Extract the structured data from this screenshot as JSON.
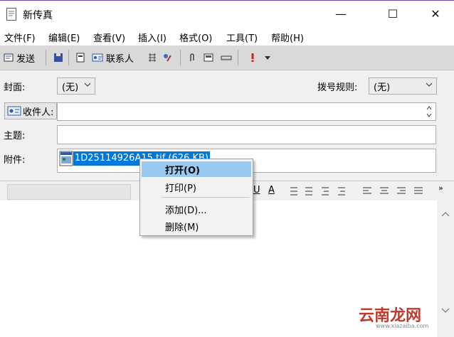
{
  "window": {
    "title": "新传真",
    "minimize": "—",
    "maximize": "☐",
    "close": "✕"
  },
  "menu": [
    "文件(F)",
    "编辑(E)",
    "查看(V)",
    "插入(I)",
    "格式(O)",
    "工具(T)",
    "帮助(H)"
  ],
  "toolbar": {
    "send_label": "发送",
    "contacts_label": "联系人"
  },
  "form": {
    "cover_label": "封面:",
    "cover_value": "(无)",
    "dial_rule_label": "拨号规则:",
    "dial_rule_value": "(无)",
    "recipient_button": "收件人:",
    "recipient_value": "",
    "subject_label": "主题:",
    "subject_value": "",
    "attachment_label": "附件:",
    "attachment_file": "1D25114926A15.tif (626 KB)"
  },
  "context_menu": {
    "items": [
      "打开(O)",
      "打印(P)",
      "添加(D)...",
      "删除(M)"
    ],
    "highlighted_index": 0
  },
  "format_bar": {
    "underline": "U",
    "font_color": "A"
  },
  "watermark": {
    "text": "云南龙网",
    "url": "www.xiazaiba.com"
  },
  "colors": {
    "selection": "#0078d7",
    "highlight": "#99c9ef",
    "accent": "#6f4aa8"
  }
}
